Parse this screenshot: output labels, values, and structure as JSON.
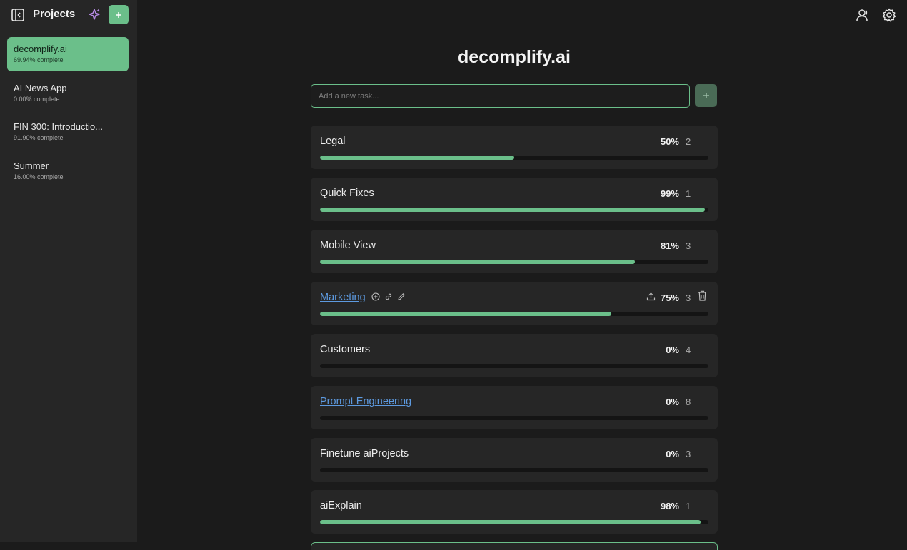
{
  "sidebar": {
    "title": "Projects",
    "projects": [
      {
        "name": "decomplify.ai",
        "subtitle": "69.94% complete"
      },
      {
        "name": "AI News App",
        "subtitle": "0.00% complete"
      },
      {
        "name": "FIN 300: Introductio...",
        "subtitle": "91.90% complete"
      },
      {
        "name": "Summer",
        "subtitle": "16.00% complete"
      }
    ]
  },
  "header": {
    "icons": [
      "sidebar-toggle-icon",
      "sparkle-icon",
      "plus-icon",
      "user-icon",
      "gear-icon"
    ]
  },
  "main": {
    "title": "decomplify.ai",
    "input_placeholder": "Add a new task...",
    "tasks": [
      {
        "name": "Legal",
        "percent": "50%",
        "count": "2",
        "progress": 0.5,
        "link": false
      },
      {
        "name": "Quick Fixes",
        "percent": "99%",
        "count": "1",
        "progress": 0.99,
        "link": false
      },
      {
        "name": "Mobile View",
        "percent": "81%",
        "count": "3",
        "progress": 0.81,
        "link": false
      },
      {
        "name": "Marketing",
        "percent": "75%",
        "count": "3",
        "progress": 0.75,
        "link": true
      },
      {
        "name": "Customers",
        "percent": "0%",
        "count": "4",
        "progress": 0,
        "link": false
      },
      {
        "name": "Prompt Engineering",
        "percent": "0%",
        "count": "8",
        "progress": 0,
        "link": true
      },
      {
        "name": "Finetune aiProjects",
        "percent": "0%",
        "count": "3",
        "progress": 0,
        "link": false
      },
      {
        "name": "aiExplain",
        "percent": "98%",
        "count": "1",
        "progress": 0.98,
        "link": false
      }
    ]
  },
  "colors": {
    "accent": "#6bbf8a",
    "link": "#5d9ae0",
    "spark": "#b98ce8"
  }
}
